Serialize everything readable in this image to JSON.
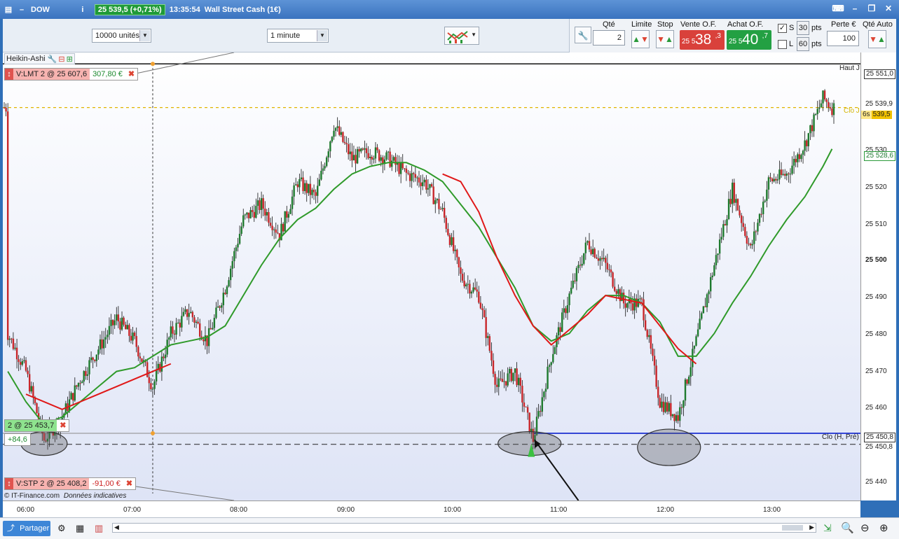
{
  "title_bar": {
    "symbol": "DOW",
    "price_change": "25 539,5 (+0,71%)",
    "time": "13:35:54",
    "instrument": "Wall Street Cash (1€)"
  },
  "toolbar": {
    "units_select": "10000 unités",
    "interval_select": "1 minute"
  },
  "order_panel": {
    "qty_label": "Qté",
    "qty_value": "2",
    "limit_label": "Limite",
    "stop_label": "Stop",
    "sell_label": "Vente O.F.",
    "sell_prefix": "25 5",
    "sell_big": "38",
    "sell_sup": ",3",
    "buy_label": "Achat O.F.",
    "buy_prefix": "25 5",
    "buy_big": "40",
    "buy_sup": ",7",
    "s_label": "S",
    "s_value": "30",
    "l_label": "L",
    "l_value": "60",
    "pts": "pts",
    "loss_label": "Perte €",
    "loss_value": "100",
    "auto_qty_label": "Qté Auto"
  },
  "chart_overlay": {
    "indicator": "Heikin-Ashi",
    "limit_order": "V:LMT  2 @ 25 607,6",
    "limit_gain": "307,80 €",
    "position": "2 @ 25 453,7",
    "position_pnl": "+84,6",
    "stop_order": "V:STP  2 @ 25 408,2",
    "stop_loss": "-91,00 €",
    "copyright": "© IT-Finance.com",
    "disclaimer": "Données indicatives",
    "high_label": "Haut J",
    "close_label": "Clo J",
    "prev_close_label": "Clo (H, Pré)",
    "countdown": "6s"
  },
  "y_axis": {
    "ticks": [
      "25 551,0",
      "25 539,9",
      "25 530",
      "25 528,6",
      "25 520",
      "25 510",
      "25 500",
      "25 490",
      "25 480",
      "25 470",
      "25 460",
      "25 450,8",
      "25 450,8",
      "25 440"
    ],
    "current": "539,5"
  },
  "x_axis": {
    "ticks": [
      "06:00",
      "07:00",
      "08:00",
      "09:00",
      "10:00",
      "11:00",
      "12:00",
      "13:00"
    ]
  },
  "bottom_bar": {
    "share": "Partager"
  },
  "chart_data": {
    "type": "candlestick",
    "ylim": [
      25436,
      25554
    ],
    "x_start": "05:58",
    "x_end": "13:36",
    "x": [
      "06:00",
      "06:10",
      "06:20",
      "06:30",
      "06:40",
      "06:50",
      "07:00",
      "07:10",
      "07:20",
      "07:30",
      "07:40",
      "07:50",
      "08:00",
      "08:10",
      "08:20",
      "08:30",
      "08:40",
      "08:50",
      "09:00",
      "09:10",
      "09:20",
      "09:30",
      "09:40",
      "09:50",
      "10:00",
      "10:10",
      "10:20",
      "10:30",
      "10:40",
      "10:50",
      "11:00",
      "11:10",
      "11:20",
      "11:30",
      "11:40",
      "11:50",
      "12:00",
      "12:10",
      "12:20",
      "12:30",
      "12:40",
      "12:50",
      "13:00",
      "13:10",
      "13:20",
      "13:30",
      "13:35"
    ],
    "close": [
      25480,
      25470,
      25452,
      25458,
      25468,
      25476,
      25484,
      25478,
      25466,
      25480,
      25486,
      25478,
      25492,
      25510,
      25514,
      25506,
      25520,
      25516,
      25535,
      25526,
      25528,
      25526,
      25522,
      25520,
      25512,
      25495,
      25490,
      25466,
      25470,
      25452,
      25474,
      25490,
      25504,
      25498,
      25488,
      25488,
      25462,
      25458,
      25478,
      25498,
      25518,
      25502,
      25520,
      25522,
      25530,
      25542,
      25539.5
    ],
    "ma_green": [
      25470,
      25462,
      25456,
      25458,
      25462,
      25466,
      25470,
      25471,
      25474,
      25477,
      25478,
      25479,
      25482,
      25490,
      25498,
      25505,
      25510,
      25513,
      25518,
      25522,
      25524,
      25525,
      25525,
      25523,
      25520,
      25514,
      25508,
      25500,
      25492,
      25482,
      25478,
      25480,
      25486,
      25490,
      25490,
      25488,
      25483,
      25474,
      25474,
      25480,
      25488,
      25495,
      25503,
      25510,
      25516,
      25524,
      25528.6
    ],
    "ma_red_x": [
      "06:10",
      "06:20",
      "06:30",
      "07:20",
      "07:30",
      "10:00",
      "10:10",
      "10:20",
      "10:30",
      "10:40",
      "10:50",
      "11:00",
      "11:20",
      "11:30",
      "11:40",
      "11:50",
      "12:00",
      "12:10",
      "12:20"
    ],
    "ma_red": [
      25464,
      25462,
      25460,
      25470,
      25472,
      25522,
      25520,
      25512,
      25500,
      25490,
      25482,
      25477,
      25485,
      25490,
      25489,
      25488,
      25482,
      25476,
      25472
    ],
    "levels": {
      "day_high": 25551.0,
      "last": 25539.5,
      "limit_order": 25607.6,
      "position": 25453.7,
      "prev_close": 25450.8,
      "stop_order": 25408.2
    }
  }
}
